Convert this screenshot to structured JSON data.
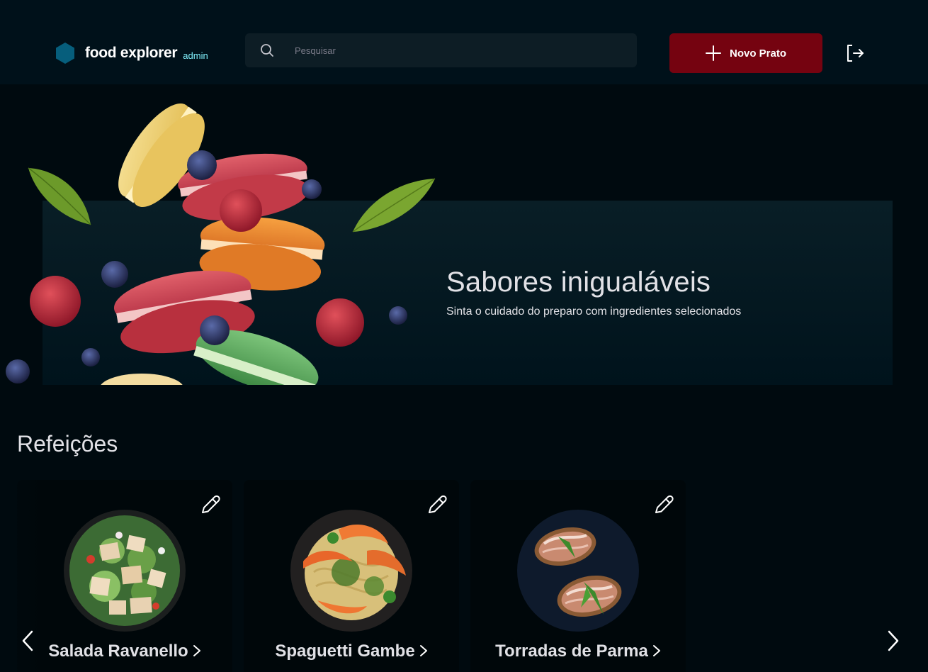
{
  "header": {
    "brand": "food explorer",
    "badge": "admin",
    "search_placeholder": "Pesquisar",
    "new_button_label": "Novo Prato"
  },
  "hero": {
    "title": "Sabores inigualáveis",
    "subtitle": "Sinta o cuidado do preparo com ingredientes selecionados"
  },
  "section": {
    "title": "Refeições"
  },
  "dishes": [
    {
      "name": "Salada Ravanello"
    },
    {
      "name": "Spaguetti Gambe"
    },
    {
      "name": "Torradas de Parma"
    }
  ],
  "colors": {
    "header_bg": "#00111a",
    "page_bg": "#000a0f",
    "accent": "#750310",
    "brand_icon": "#065e7c",
    "badge": "#82f3ff"
  },
  "icons": [
    "hexagon-logo-icon",
    "search-icon",
    "plus-icon",
    "sign-out-icon",
    "pencil-icon",
    "chevron-right-icon",
    "chevron-left-icon"
  ]
}
